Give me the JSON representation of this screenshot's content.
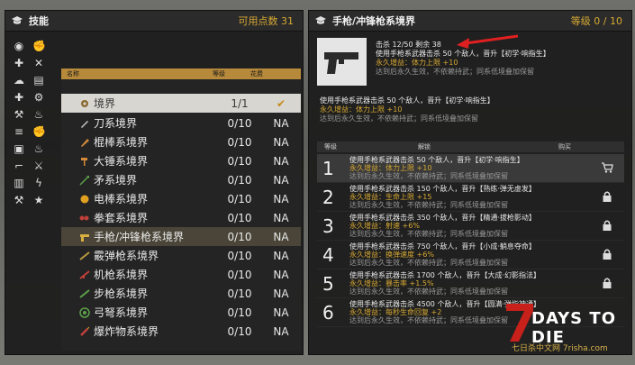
{
  "left_panel": {
    "title": "技能",
    "points_label": "可用点数 31",
    "list_headers": {
      "name": "名称",
      "level": "等级",
      "cost": "花费"
    },
    "rows": [
      {
        "name": "境界",
        "level": "1/1",
        "status": "✔"
      },
      {
        "name": "刀系境界",
        "level": "0/10",
        "status": "NA"
      },
      {
        "name": "棍棒系境界",
        "level": "0/10",
        "status": "NA"
      },
      {
        "name": "大锤系境界",
        "level": "0/10",
        "status": "NA"
      },
      {
        "name": "矛系境界",
        "level": "0/10",
        "status": "NA"
      },
      {
        "name": "电棒系境界",
        "level": "0/10",
        "status": "NA"
      },
      {
        "name": "拳套系境界",
        "level": "0/10",
        "status": "NA"
      },
      {
        "name": "手枪/冲锋枪系境界",
        "level": "0/10",
        "status": "NA"
      },
      {
        "name": "霰弹枪系境界",
        "level": "0/10",
        "status": "NA"
      },
      {
        "name": "机枪系境界",
        "level": "0/10",
        "status": "NA"
      },
      {
        "name": "步枪系境界",
        "level": "0/10",
        "status": "NA"
      },
      {
        "name": "弓弩系境界",
        "level": "0/10",
        "status": "NA"
      },
      {
        "name": "爆炸物系境界",
        "level": "0/10",
        "status": "NA"
      }
    ]
  },
  "right_panel": {
    "title": "手枪/冲锋枪系境界",
    "level_label": "等级 0 / 10",
    "kill_progress": "击杀 12/50 剩余 38",
    "desc_main": "使用手枪系武器击杀 50 个敌人，晋升【初学·响指生】",
    "desc_bonus": "永久增益：体力上限 +10",
    "desc_note": "达到后永久生效，不依赖持武；同系低境叠加保留",
    "desc2_main": "使用手枪系武器击杀 50 个敌人，晋升【初学·响指生】",
    "desc2_bonus": "永久增益：体力上限 +10",
    "desc2_note": "达到后永久生效，不依赖持武；同系低境叠加保留",
    "table_headers": {
      "level": "等级",
      "unlock": "解锁",
      "buy": "购买"
    },
    "tiers": [
      {
        "num": "1",
        "l1": "使用手枪系武器击杀 50 个敌人，晋升【初学·响指生】",
        "l2": "永久增益：体力上限 +10",
        "l3": "达到后永久生效，不依赖持武；同系低境叠加保留"
      },
      {
        "num": "2",
        "l1": "使用手枪系武器击杀 150 个敌人，晋升【熟练·弹无虚发】",
        "l2": "永久增益：生命上限 +15",
        "l3": "达到后永久生效，不依赖持武；同系低境叠加保留"
      },
      {
        "num": "3",
        "l1": "使用手枪系武器击杀 350 个敌人，晋升【精通·拔枪影动】",
        "l2": "永久增益：射速 +6%",
        "l3": "达到后永久生效，不依赖持武；同系低境叠加保留"
      },
      {
        "num": "4",
        "l1": "使用手枪系武器击杀 750 个敌人，晋升【小成·躺息夺命】",
        "l2": "永久增益：换弹速度 +6%",
        "l3": "达到后永久生效，不依赖持武；同系低境叠加保留"
      },
      {
        "num": "5",
        "l1": "使用手枪系武器击杀 1700 个敌人，晋升【大成·幻影指法】",
        "l2": "永久增益：暴击率 +1.5%",
        "l3": "达到后永久生效，不依赖持武；同系低境叠加保留"
      },
      {
        "num": "6",
        "l1": "使用手枪系武器击杀 4500 个敌人，晋升【圆满·弹指神通】",
        "l2": "永久增益：每秒生命回复 +2",
        "l3": "达到后永久生效，不依赖持武；同系低境叠加保留"
      }
    ]
  },
  "watermark": {
    "title": "DAYS TO DIE",
    "sub": "七日杀中文网 7risha.com"
  },
  "colors": {
    "accent": "#d7a933",
    "header_bar": "#b7893a",
    "panel": "#1c1c1c"
  }
}
